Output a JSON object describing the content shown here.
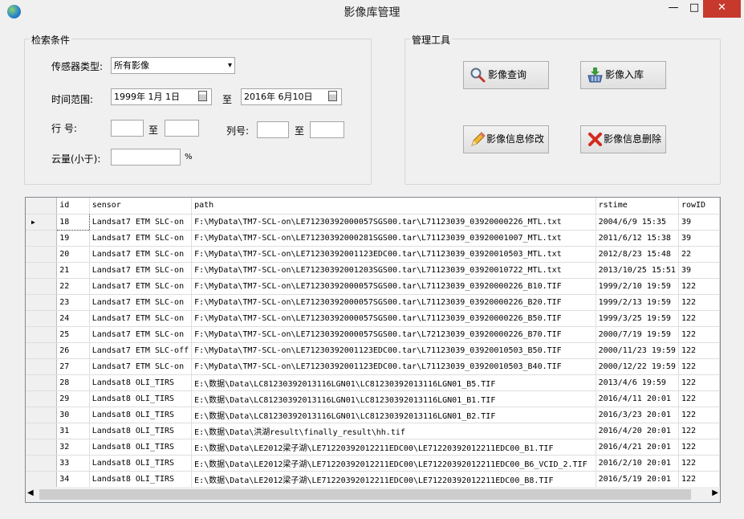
{
  "window": {
    "title": "影像库管理",
    "min": "—",
    "max": "□",
    "close": "✕"
  },
  "search": {
    "group_title": "检索条件",
    "sensor_label": "传感器类型:",
    "sensor_value": "所有影像",
    "time_label": "时间范围:",
    "date_from": "1999年 1月 1日",
    "to1": "至",
    "date_to": "2016年 6月10日",
    "row_label": "行    号:",
    "to2": "至",
    "col_label": "列号:",
    "to3": "至",
    "cloud_label": "云量(小于):",
    "percent": "%"
  },
  "tools": {
    "group_title": "管理工具",
    "query": "影像查询",
    "import": "影像入库",
    "edit": "影像信息修改",
    "delete": "影像信息删除"
  },
  "grid": {
    "columns": [
      "id",
      "sensor",
      "path",
      "rstime",
      "rowID"
    ],
    "rows": [
      [
        "18",
        "Landsat7 ETM SLC-on",
        "F:\\MyData\\TM7-SCL-on\\LE71230392000057SGS00.tar\\L71123039_03920000226_MTL.txt",
        "2004/6/9 15:35",
        "39"
      ],
      [
        "19",
        "Landsat7 ETM SLC-on",
        "F:\\MyData\\TM7-SCL-on\\LE71230392000281SGS00.tar\\L71123039_03920001007_MTL.txt",
        "2011/6/12 15:38",
        "39"
      ],
      [
        "20",
        "Landsat7 ETM SLC-on",
        "F:\\MyData\\TM7-SCL-on\\LE71230392001123EDC00.tar\\L71123039_03920010503_MTL.txt",
        "2012/8/23 15:48",
        "22"
      ],
      [
        "21",
        "Landsat7 ETM SLC-on",
        "F:\\MyData\\TM7-SCL-on\\LE71230392001203SGS00.tar\\L71123039_03920010722_MTL.txt",
        "2013/10/25 15:51",
        "39"
      ],
      [
        "22",
        "Landsat7 ETM SLC-on",
        "F:\\MyData\\TM7-SCL-on\\LE71230392000057SGS00.tar\\L71123039_03920000226_B10.TIF",
        "1999/2/10 19:59",
        "122"
      ],
      [
        "23",
        "Landsat7 ETM SLC-on",
        "F:\\MyData\\TM7-SCL-on\\LE71230392000057SGS00.tar\\L71123039_03920000226_B20.TIF",
        "1999/2/13 19:59",
        "122"
      ],
      [
        "24",
        "Landsat7 ETM SLC-on",
        "F:\\MyData\\TM7-SCL-on\\LE71230392000057SGS00.tar\\L71123039_03920000226_B50.TIF",
        "1999/3/25 19:59",
        "122"
      ],
      [
        "25",
        "Landsat7 ETM SLC-on",
        "F:\\MyData\\TM7-SCL-on\\LE71230392000057SGS00.tar\\L72123039_03920000226_B70.TIF",
        "2000/7/19 19:59",
        "122"
      ],
      [
        "26",
        "Landsat7 ETM SLC-off",
        "F:\\MyData\\TM7-SCL-on\\LE71230392001123EDC00.tar\\L71123039_03920010503_B50.TIF",
        "2000/11/23 19:59",
        "122"
      ],
      [
        "27",
        "Landsat7 ETM SLC-on",
        "F:\\MyData\\TM7-SCL-on\\LE71230392001123EDC00.tar\\L71123039_03920010503_B40.TIF",
        "2000/12/22 19:59",
        "122"
      ],
      [
        "28",
        "Landsat8 OLI_TIRS",
        "E:\\数据\\Data\\LC81230392013116LGN01\\LC81230392013116LGN01_B5.TIF",
        "2013/4/6 19:59",
        "122"
      ],
      [
        "29",
        "Landsat8 OLI_TIRS",
        "E:\\数据\\Data\\LC81230392013116LGN01\\LC81230392013116LGN01_B1.TIF",
        "2016/4/11 20:01",
        "122"
      ],
      [
        "30",
        "Landsat8 OLI_TIRS",
        "E:\\数据\\Data\\LC81230392013116LGN01\\LC81230392013116LGN01_B2.TIF",
        "2016/3/23 20:01",
        "122"
      ],
      [
        "31",
        "Landsat8 OLI_TIRS",
        "E:\\数据\\Data\\洪湖result\\finally_result\\hh.tif",
        "2016/4/20 20:01",
        "122"
      ],
      [
        "32",
        "Landsat8 OLI_TIRS",
        "E:\\数据\\Data\\LE2012梁子湖\\LE71220392012211EDC00\\LE71220392012211EDC00_B1.TIF",
        "2016/4/21 20:01",
        "122"
      ],
      [
        "33",
        "Landsat8 OLI_TIRS",
        "E:\\数据\\Data\\LE2012梁子湖\\LE71220392012211EDC00\\LE71220392012211EDC00_B6_VCID_2.TIF",
        "2016/2/10 20:01",
        "122"
      ],
      [
        "34",
        "Landsat8 OLI_TIRS",
        "E:\\数据\\Data\\LE2012梁子湖\\LE71220392012211EDC00\\LE71220392012211EDC00_B8.TIF",
        "2016/5/19 20:01",
        "122"
      ]
    ]
  }
}
